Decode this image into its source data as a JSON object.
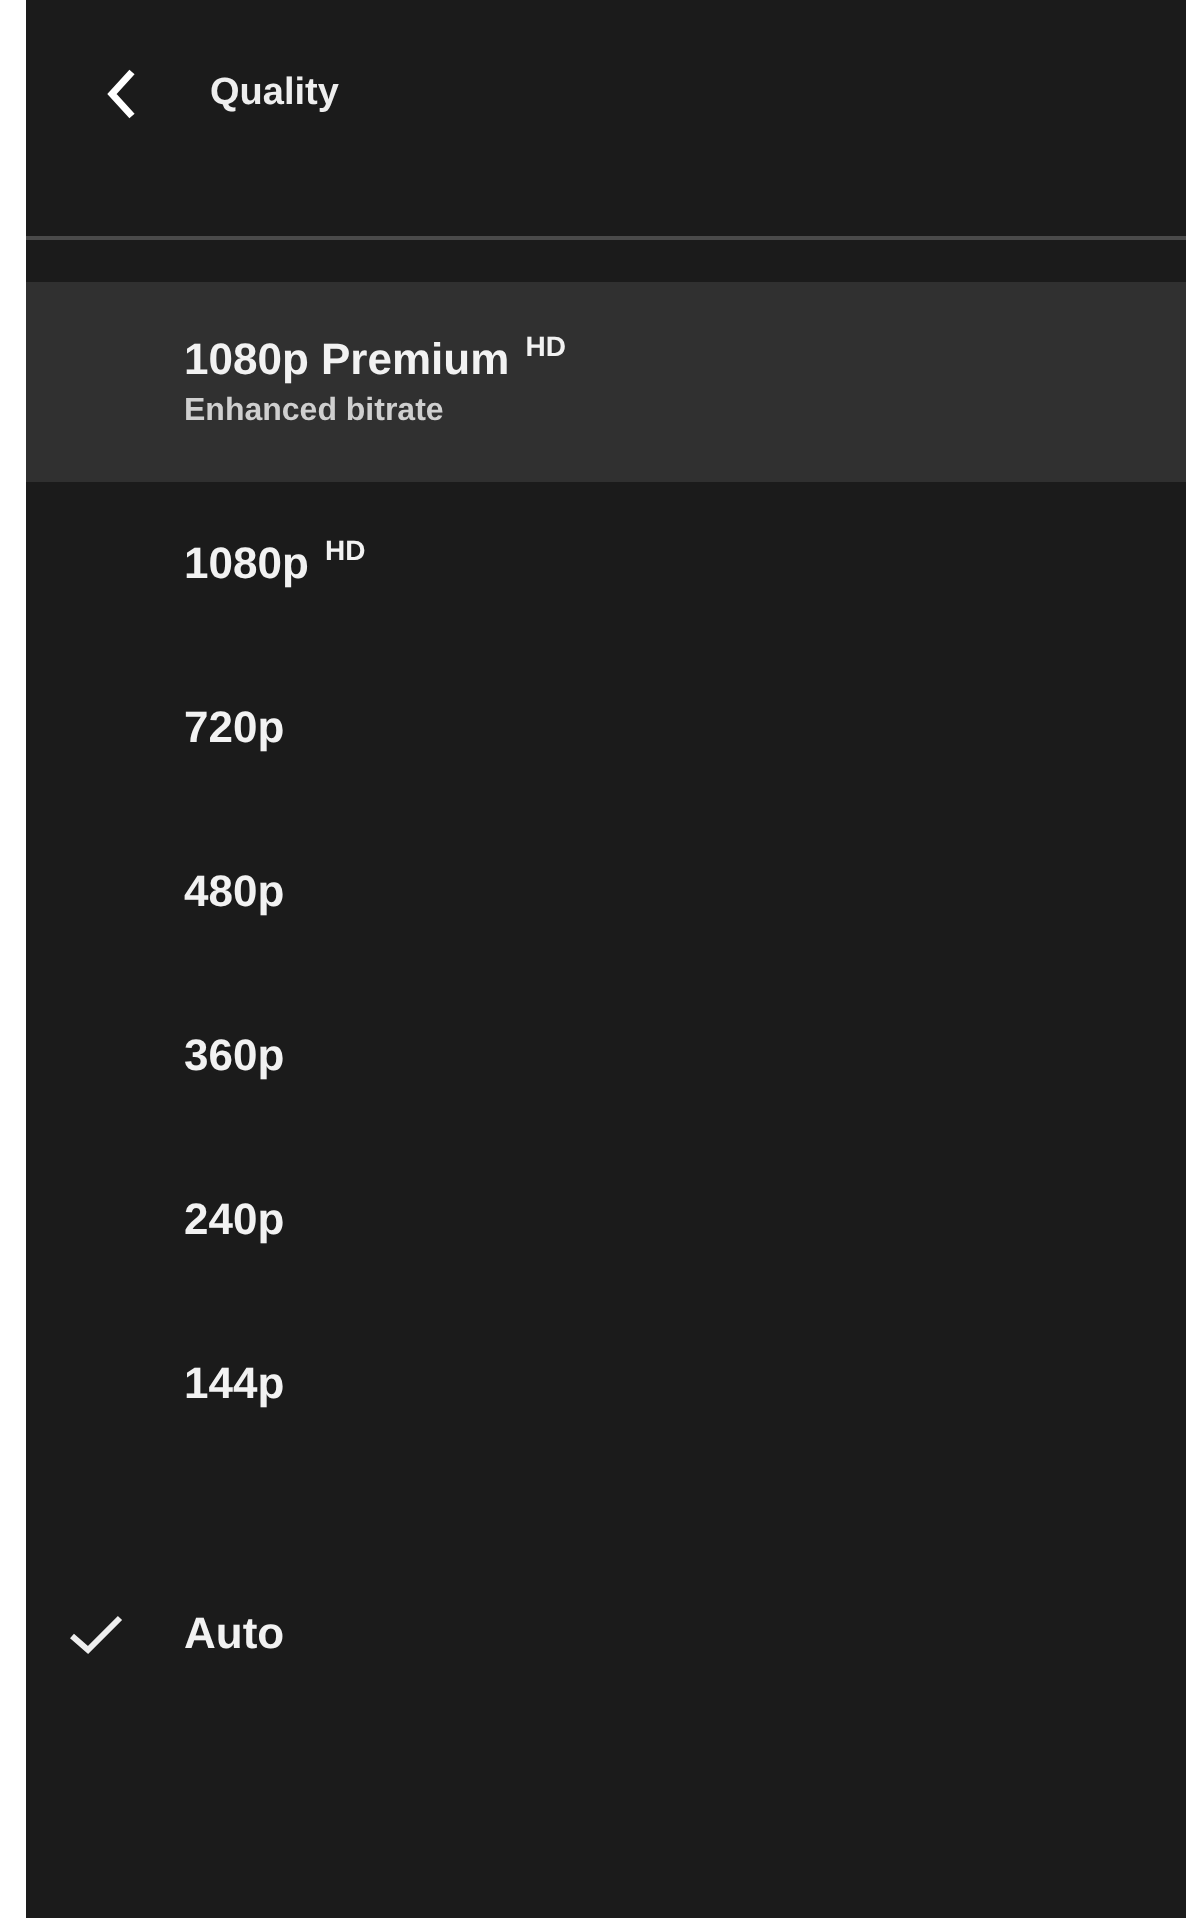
{
  "header": {
    "title": "Quality"
  },
  "options": [
    {
      "label": "1080p Premium $^{HD}$",
      "sublabel": "Enhanced bitrate",
      "focused": true,
      "selected": false
    },
    {
      "label": "1080p $^{HD}$",
      "focused": false,
      "selected": false
    },
    {
      "label": "720p",
      "focused": false,
      "selected": false
    },
    {
      "label": "480p",
      "focused": false,
      "selected": false
    },
    {
      "label": "360p",
      "focused": false,
      "selected": false
    },
    {
      "label": "240p",
      "focused": false,
      "selected": false
    },
    {
      "label": "144p",
      "focused": false,
      "selected": false
    },
    {
      "label": "Auto",
      "focused": false,
      "selected": true
    }
  ]
}
